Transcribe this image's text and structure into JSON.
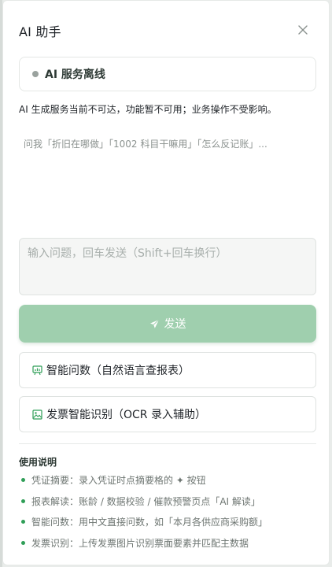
{
  "panel": {
    "title": "AI 助手",
    "close_icon": "close-icon"
  },
  "status": {
    "label": "AI 服务离线",
    "dot_color": "#9aa29e"
  },
  "offline_note": "AI 生成服务当前不可达，功能暂不可用；业务操作不受影响。",
  "suggestions": "问我「折旧在哪做」「1002 科目干嘛用」「怎么反记账」...",
  "input": {
    "placeholder": "输入问题，回车发送（Shift+回车换行）",
    "value": ""
  },
  "send_button": {
    "label": "发送",
    "icon": "send-icon",
    "color": "#9fcfae"
  },
  "actions": [
    {
      "label": "智能问数（自然语言查报表）",
      "icon": "chart-icon"
    },
    {
      "label": "发票智能识别（OCR 录入辅助）",
      "icon": "image-icon"
    }
  ],
  "help": {
    "title": "使用说明",
    "items": [
      "凭证摘要：录入凭证时点摘要格的 ✦ 按钮",
      "报表解读：账龄 / 数据校验 / 催款预警页点「AI 解读」",
      "智能问数：用中文直接问数，如「本月各供应商采购额」",
      "发票识别：上传发票图片识别票面要素并匹配主数据"
    ],
    "bullet_color": "#2f9e57"
  },
  "accent_color": "#2f9e57"
}
